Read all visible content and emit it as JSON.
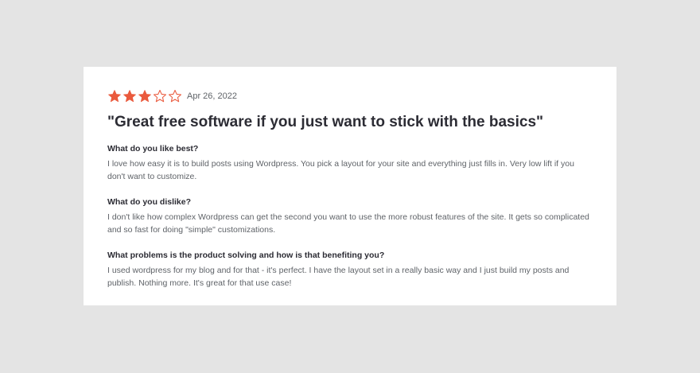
{
  "review": {
    "rating": 3,
    "max_rating": 5,
    "star_color": "#ea5a3d",
    "date": "Apr 26, 2022",
    "title": "\"Great free software if you just want to stick with the basics\"",
    "sections": [
      {
        "question": "What do you like best?",
        "answer": "I love how easy it is to build posts using Wordpress. You pick a layout for your site and everything just fills in. Very low lift if you don't want to customize."
      },
      {
        "question": "What do you dislike?",
        "answer": "I don't like how complex Wordpress can get the second you want to use the more robust features of the site. It gets so complicated and so fast for doing \"simple\" customizations."
      },
      {
        "question": "What problems is the product solving and how is that benefiting you?",
        "answer": "I used wordpress for my blog and for that - it's perfect. I have the layout set in a really basic way and I just build my posts and publish. Nothing more. It's great for that use case!"
      }
    ]
  }
}
